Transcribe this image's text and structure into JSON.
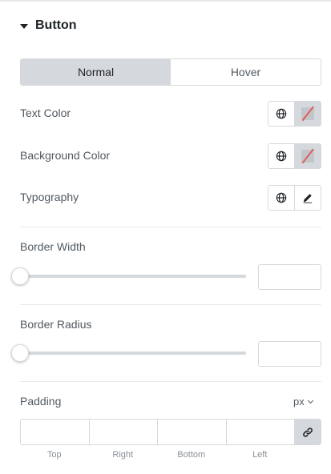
{
  "section": {
    "title": "Button"
  },
  "tabs": [
    {
      "label": "Normal",
      "active": true
    },
    {
      "label": "Hover",
      "active": false
    }
  ],
  "controls": {
    "text_color_label": "Text Color",
    "background_color_label": "Background Color",
    "typography_label": "Typography",
    "border_width_label": "Border Width",
    "border_width_value": "",
    "border_radius_label": "Border Radius",
    "border_radius_value": "",
    "padding_label": "Padding",
    "padding_unit": "px"
  },
  "padding": {
    "fields": [
      {
        "label": "Top",
        "value": ""
      },
      {
        "label": "Right",
        "value": ""
      },
      {
        "label": "Bottom",
        "value": ""
      },
      {
        "label": "Left",
        "value": ""
      }
    ]
  },
  "icons": {
    "caret": "caret-down-icon",
    "globe": "globe-icon",
    "pencil": "pencil-icon",
    "link": "link-icon",
    "chevron": "chevron-down-icon"
  },
  "colors": {
    "tab_active_bg": "#d5d8dc",
    "swatch_empty_slash": "#e35c5c",
    "title_text": "#1d2327",
    "label_text": "#515962"
  }
}
